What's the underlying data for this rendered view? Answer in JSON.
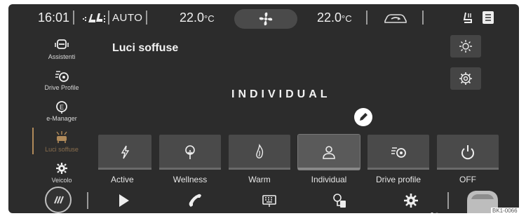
{
  "topbar": {
    "time": "16:01",
    "auto_label": "AUTO",
    "temp_left": "22.0",
    "temp_left_unit": "°C",
    "temp_right": "22.0",
    "temp_right_unit": "°C",
    "icons": [
      "seat-airflow-icon",
      "fan-icon",
      "car-air-recirculation-icon",
      "seat-heat-icon",
      "menu-icon"
    ]
  },
  "sidebar": {
    "items": [
      {
        "label": "Assistenti",
        "icon": "assist-icon"
      },
      {
        "label": "Drive Profile",
        "icon": "drive-profile-icon"
      },
      {
        "label": "e-Manager",
        "icon": "e-manager-icon"
      },
      {
        "label": "Luci soffuse",
        "icon": "ambient-light-icon",
        "active": true
      },
      {
        "label": "Veicolo",
        "icon": "vehicle-gear-icon"
      }
    ]
  },
  "main": {
    "title": "Luci soffuse",
    "mode": "INDIVIDUAL",
    "tiles": [
      {
        "label": "Active",
        "icon": "lightning-icon"
      },
      {
        "label": "Wellness",
        "icon": "tree-icon"
      },
      {
        "label": "Warm",
        "icon": "flame-icon"
      },
      {
        "label": "Individual",
        "icon": "person-icon",
        "selected": true
      },
      {
        "label": "Drive profile",
        "icon": "drive-profile-icon"
      },
      {
        "label": "OFF",
        "icon": "power-icon"
      }
    ]
  },
  "bottombar": {
    "icons": [
      "home-icon",
      "play-icon",
      "phone-icon",
      "keyboard-icon",
      "charging-icon",
      "settings-icon",
      "vehicle-icon"
    ]
  },
  "reference_code": "BK1-0066"
}
